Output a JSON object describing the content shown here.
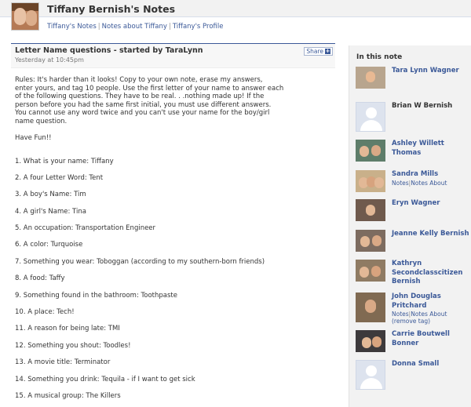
{
  "header": {
    "title": "Tiffany Bernish's Notes"
  },
  "nav": {
    "links": [
      "Tiffany's Notes",
      "Notes about Tiffany",
      "Tiffany's Profile"
    ],
    "separator": "|"
  },
  "note": {
    "title": "Letter Name questions - started by TaraLynn",
    "timestamp": "Yesterday at 10:45pm",
    "share_label": "Share",
    "share_icon": "+",
    "rules": "Rules: It's harder than it looks! Copy to your own note, erase my answers,\nenter yours, and tag 10 people. Use the first letter of your name to answer each\nof the following questions. They have to be real. . .nothing made up! If the\nperson before you had the same first initial, you must use different answers.\nYou cannot use any word twice and you can't use your name for the boy/girl\nname question.",
    "have_fun": "Have Fun!!",
    "answers": [
      "1. What is your name: Tiffany",
      "2. A four Letter Word: Tent",
      "3. A boy's Name: Tim",
      "4. A girl's Name: Tina",
      "5. An occupation: Transportation Engineer",
      "6. A color: Turquoise",
      "7. Something you wear: Toboggan (according to my southern-born friends)",
      "8. A food: Taffy",
      "9. Something found in the bathroom: Toothpaste",
      "10. A place: Tech!",
      "11. A reason for being late: TMI",
      "12. Something you shout: Toodles!",
      "13. A movie title: Terminator",
      "14. Something you drink: Tequila - if I want to get sick",
      "15. A musical group: The Killers"
    ]
  },
  "sidebar": {
    "title": "In this note",
    "people": [
      {
        "name": "Tara Lynn Wagner",
        "links": []
      },
      {
        "name": "Brian W Bernish",
        "links": []
      },
      {
        "name": "Ashley Willett Thomas",
        "links": []
      },
      {
        "name": "Sandra Mills",
        "links": [
          "Notes",
          "Notes About"
        ]
      },
      {
        "name": "Eryn Wagner",
        "links": []
      },
      {
        "name": "Jeanne Kelly Bernish",
        "links": []
      },
      {
        "name": "Kathryn Secondclasscitizen Bernish",
        "links": []
      },
      {
        "name": "John Douglas Pritchard",
        "links": [
          "Notes",
          "Notes About"
        ],
        "extra_link": "(remove tag)"
      },
      {
        "name": "Carrie Boutwell Bonner",
        "links": []
      },
      {
        "name": "Donna Small",
        "links": []
      }
    ]
  },
  "colors": {
    "link": "#3b5998",
    "header_bg": "#f2f2f2",
    "sidebar_bg": "#f2f2f2"
  }
}
